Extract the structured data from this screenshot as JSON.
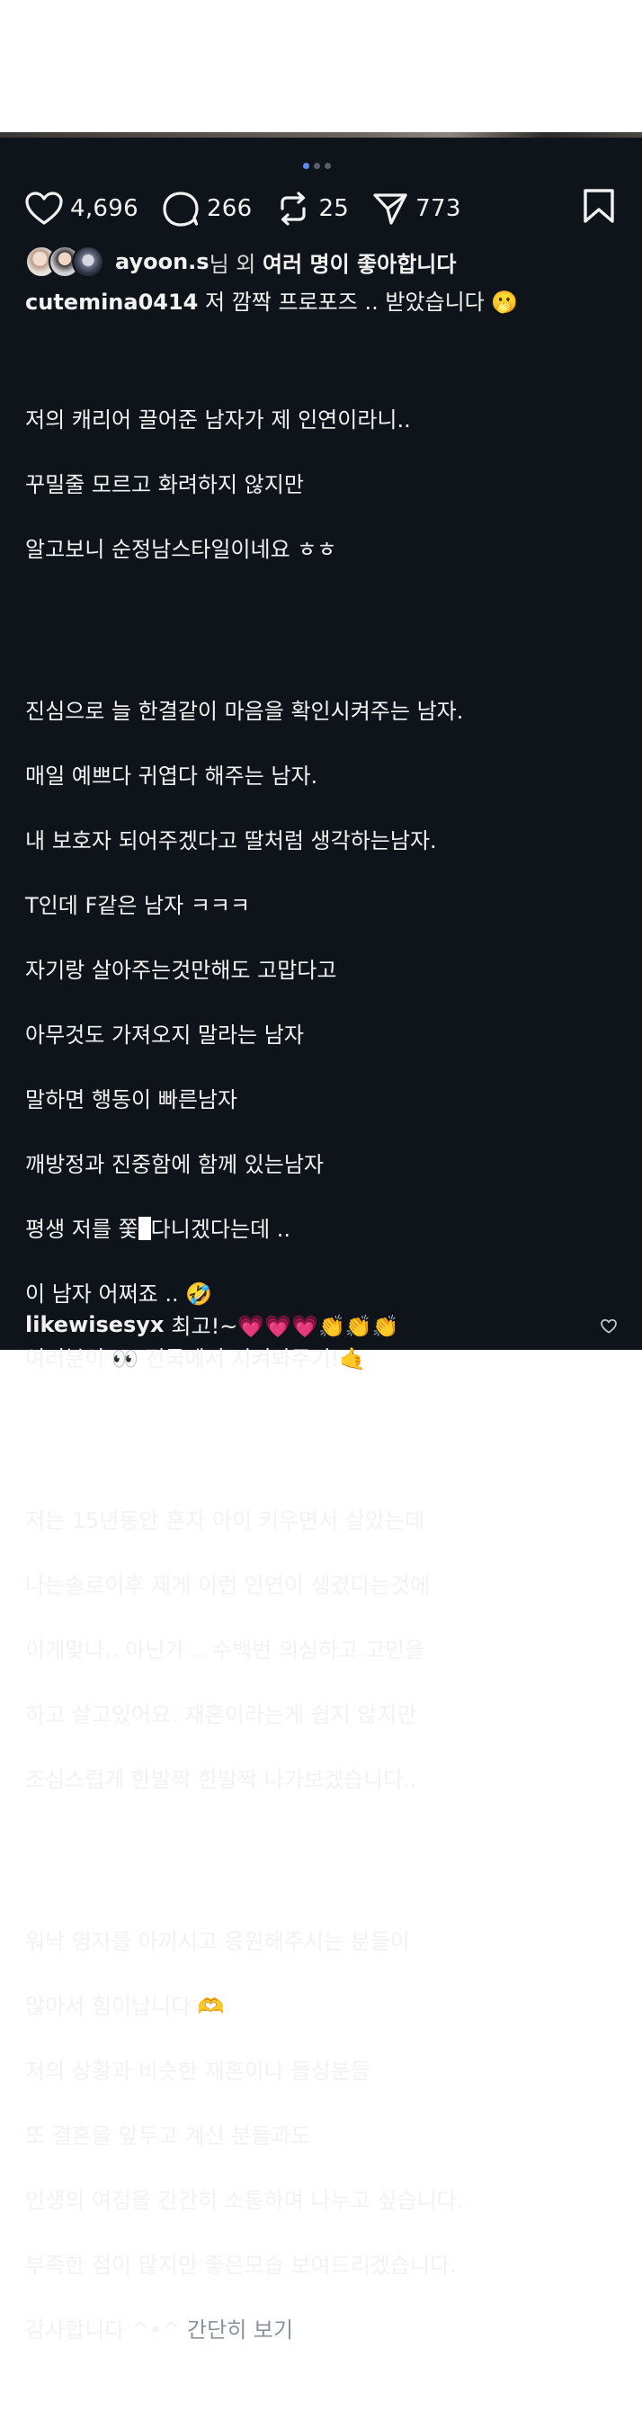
{
  "carousel": {
    "count": 3,
    "active": 0
  },
  "actions": {
    "likes": "4,696",
    "comments": "266",
    "reposts": "25",
    "shares": "773"
  },
  "liked_by": {
    "user": "ayoon.s",
    "suffix": "님 외 ",
    "rest": "여러 명이 좋아합니다"
  },
  "caption": {
    "username": "cutemina0414",
    "headline": "저 깜짝 프로포즈 .. 받았습니다 🫢",
    "paragraphs": [
      [
        "저의 캐리어 끌어준 남자가 제 인연이라니..",
        "꾸밀줄 모르고 화려하지 않지만",
        "알고보니 순정남스타일이네요 ㅎㅎ"
      ],
      [
        "진심으로 늘 한결같이 마음을 확인시켜주는 남자.",
        "매일 예쁘다 귀엽다 해주는 남자.",
        "내 보호자 되어주겠다고 딸처럼 생각하는남자.",
        "T인데 F같은 남자 ㅋㅋㅋ",
        "자기랑 살아주는것만해도 고맙다고",
        "아무것도 가져오지 말라는 남자",
        "말하면 행동이 빠른남자",
        "깨방정과 진중함에 함께 있는남자"
      ],
      [
        "저는 15년동안 혼자 아이 키우면서 살았는데",
        "나는솔로이후 제게 이런 인연이 생겼다는것에",
        "이게맞나.. 아닌가 .. 수백번 의심하고 고민을",
        "하고 살고있어요. 재혼이라는게 쉽지 않지만",
        "조심스럽게 한발짝 한발짝 나가보겠습니다.."
      ],
      [
        "워낙 영자를 아끼시고 응원해주시는 분들이",
        "많아서 힘이납니다 🫶",
        "저의 상황과 비슷한 재혼이나 돌싱분들",
        "또 결혼을 앞두고 계신 분들과도",
        "인생의 여정을 간간히 소통하며 나누고 싶습니다.",
        "부족한 점이 많지만 좋은모습 보여드리겠습니다."
      ]
    ],
    "censored_line_before": "평생 저를 쫓",
    "censored_line_after": "다니겠다는데 ..",
    "line_after_censored_1": "이 남자 어쩌죠 .. 🤣",
    "line_after_censored_2": "여러분이 👀 전국에서 지켜봐주기!🤙",
    "closing": "감사합니다 ^•^ ",
    "collapse": "간단히 보기"
  },
  "comment": {
    "username": "likewisesyx",
    "text": "최고!~💗💗💗👏👏👏"
  },
  "colors": {
    "background": "#0f141a",
    "text": "#f2f2f2",
    "muted": "#8a929c",
    "accent_dot": "#5b8def"
  }
}
